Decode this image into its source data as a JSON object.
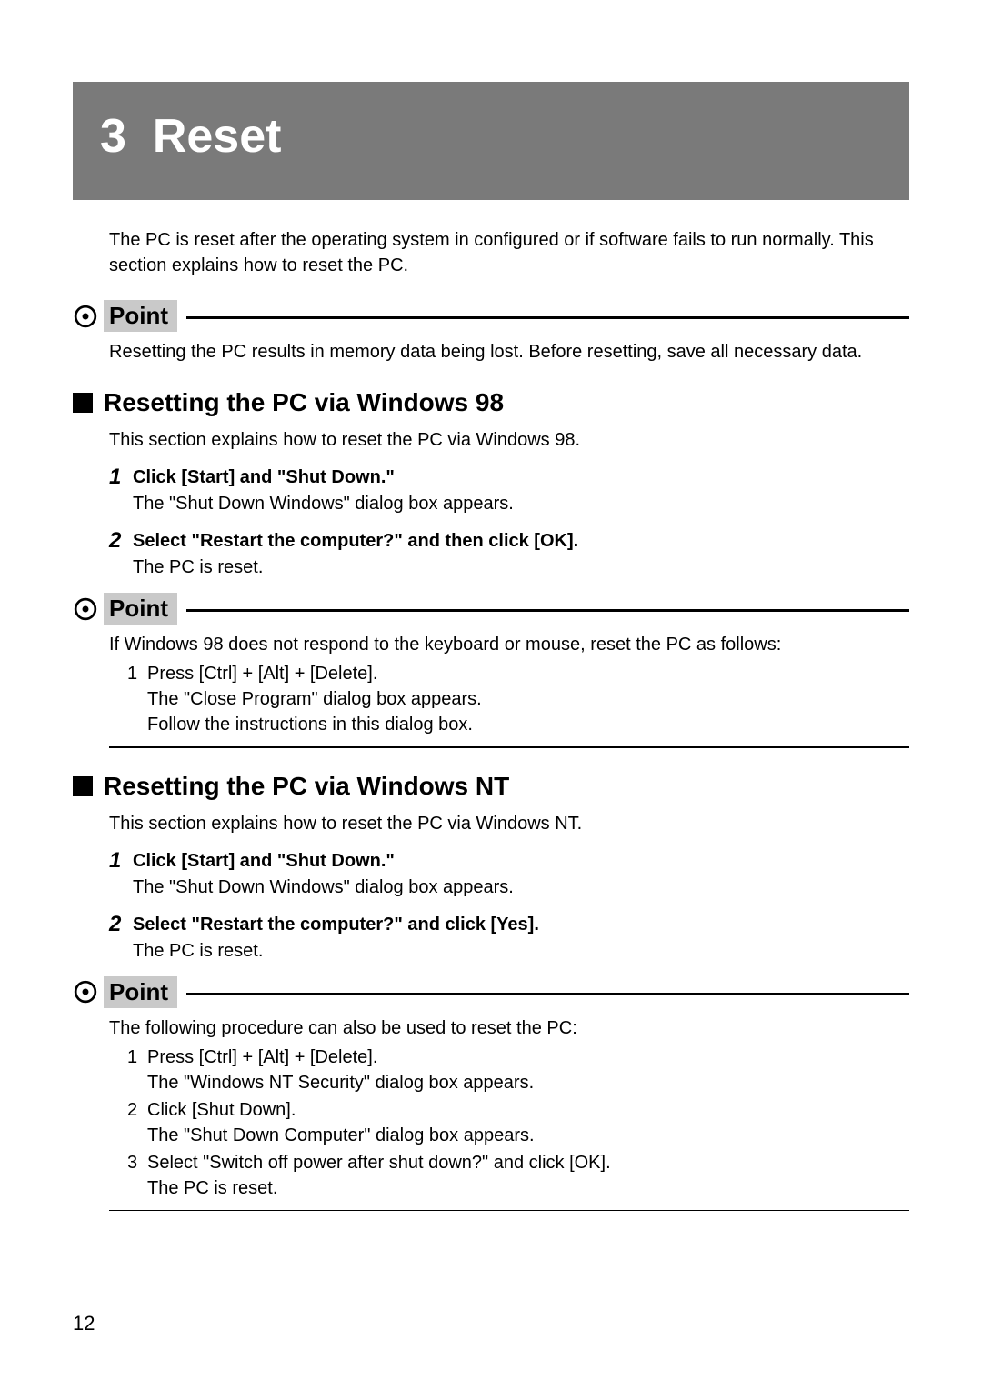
{
  "chapter": {
    "number": "3",
    "title": "Reset"
  },
  "intro": "The PC is reset after the operating system in configured or if software fails to run normally.  This section explains how to reset the PC.",
  "point1": {
    "label": "Point",
    "body": "Resetting the PC results in memory data being lost.  Before resetting, save all necessary data."
  },
  "section1": {
    "heading": "Resetting the PC via Windows 98",
    "intro": "This section explains how to reset the PC via Windows 98.",
    "steps": [
      {
        "num": "1",
        "title": "Click [Start] and \"Shut Down.\"",
        "desc": "The \"Shut Down Windows\" dialog box appears."
      },
      {
        "num": "2",
        "title": "Select \"Restart the computer?\" and then click [OK].",
        "desc": "The PC is reset."
      }
    ]
  },
  "point2": {
    "label": "Point",
    "lead": "If Windows 98 does not respond to the keyboard or mouse, reset the PC as follows:",
    "items": [
      {
        "num": "1",
        "line1": "Press [Ctrl] + [Alt] + [Delete].",
        "line2": "The \"Close Program\" dialog box appears.",
        "line3": "Follow the instructions in this dialog box."
      }
    ]
  },
  "section2": {
    "heading": "Resetting the PC via Windows NT",
    "intro": "This section explains how to reset the PC via Windows NT.",
    "steps": [
      {
        "num": "1",
        "title": "Click [Start] and \"Shut Down.\"",
        "desc": "The \"Shut Down Windows\" dialog box appears."
      },
      {
        "num": "2",
        "title": "Select \"Restart the computer?\" and click [Yes].",
        "desc": "The PC is reset."
      }
    ]
  },
  "point3": {
    "label": "Point",
    "lead": "The following procedure can also be used to reset the PC:",
    "items": [
      {
        "num": "1",
        "line1": "Press [Ctrl] + [Alt] + [Delete].",
        "line2": "The \"Windows NT Security\" dialog box appears."
      },
      {
        "num": "2",
        "line1": "Click [Shut Down].",
        "line2": "The \"Shut Down Computer\" dialog box appears."
      },
      {
        "num": "3",
        "line1": "Select \"Switch off power after shut down?\" and click [OK].",
        "line2": "The PC is reset."
      }
    ]
  },
  "page_number": "12"
}
